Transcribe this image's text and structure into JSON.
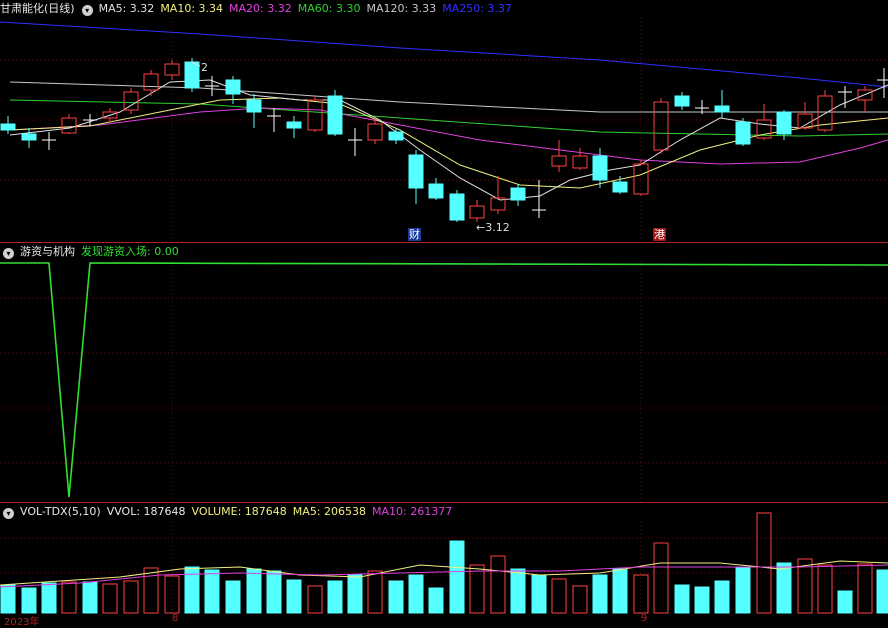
{
  "price_pane": {
    "title": "甘肃能化(日线)",
    "indicators": [
      {
        "label": "MA5: 3.32",
        "color": "#e0e0e0"
      },
      {
        "label": "MA10: 3.34",
        "color": "#f0f080"
      },
      {
        "label": "MA20: 3.32",
        "color": "#e040e0"
      },
      {
        "label": "MA60: 3.30",
        "color": "#30d030"
      },
      {
        "label": "MA120: 3.33",
        "color": "#c8c8c8"
      },
      {
        "label": "MA250: 3.37",
        "color": "#3030ff"
      }
    ],
    "high_marker": "2",
    "low_marker": "3.12",
    "event_labels": [
      "财",
      "港"
    ]
  },
  "indicator_pane": {
    "title": "游资与机构",
    "value_label": "发现游资入场: 0.00"
  },
  "volume_pane": {
    "title": "VOL-TDX(5,10)",
    "vvol": "VVOL: 187648",
    "volume": "VOLUME: 187648",
    "ma5": "MA5: 206538",
    "ma10": "MA10: 261377"
  },
  "x_axis": {
    "labels": [
      "2023年",
      "8",
      "9"
    ]
  },
  "colors": {
    "up": "#ff4040",
    "down": "#54ffff",
    "ma5": "#e0e0e0",
    "ma10": "#f0f080",
    "ma20": "#e040e0",
    "ma60": "#30d030",
    "ma120": "#c8c8c8",
    "ma250": "#3030ff",
    "signal": "#30e030"
  }
}
